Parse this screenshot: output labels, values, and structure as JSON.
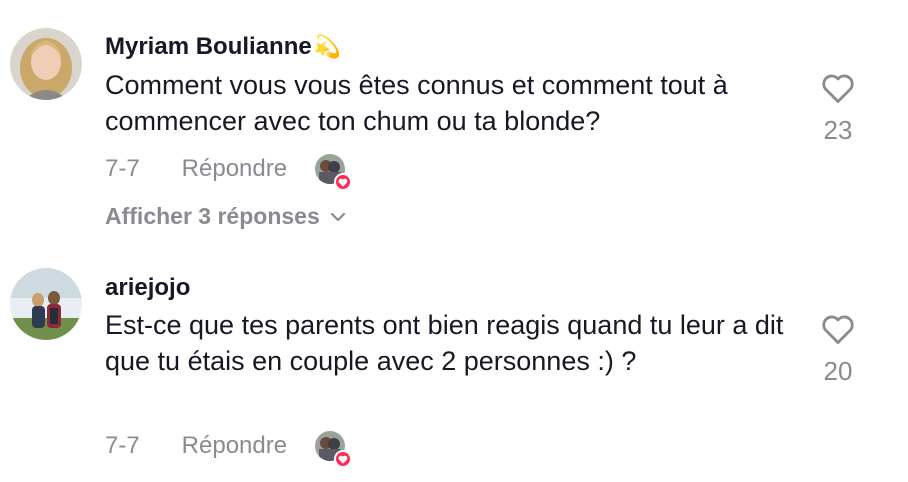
{
  "comments": [
    {
      "username": "Myriam Boulianne",
      "username_emoji": "💫",
      "text": "Comment vous vous êtes connus et comment tout à commencer avec ton chum ou ta blonde?",
      "date": "7-7",
      "reply_label": "Répondre",
      "like_count": "23",
      "view_replies_label": "Afficher 3 réponses"
    },
    {
      "username": "ariejojo",
      "text": "Est-ce que tes parents ont bien reagis quand tu leur a dit que tu étais en couple avec 2 personnes :) ?",
      "date": "7-7",
      "reply_label": "Répondre",
      "like_count": "20"
    }
  ],
  "colors": {
    "text_primary": "#161823",
    "text_secondary": "#8a8b91",
    "accent_heart": "#fe2c55"
  },
  "icons": [
    "heart-outline-icon",
    "chevron-down-icon",
    "heart-badge-icon"
  ]
}
